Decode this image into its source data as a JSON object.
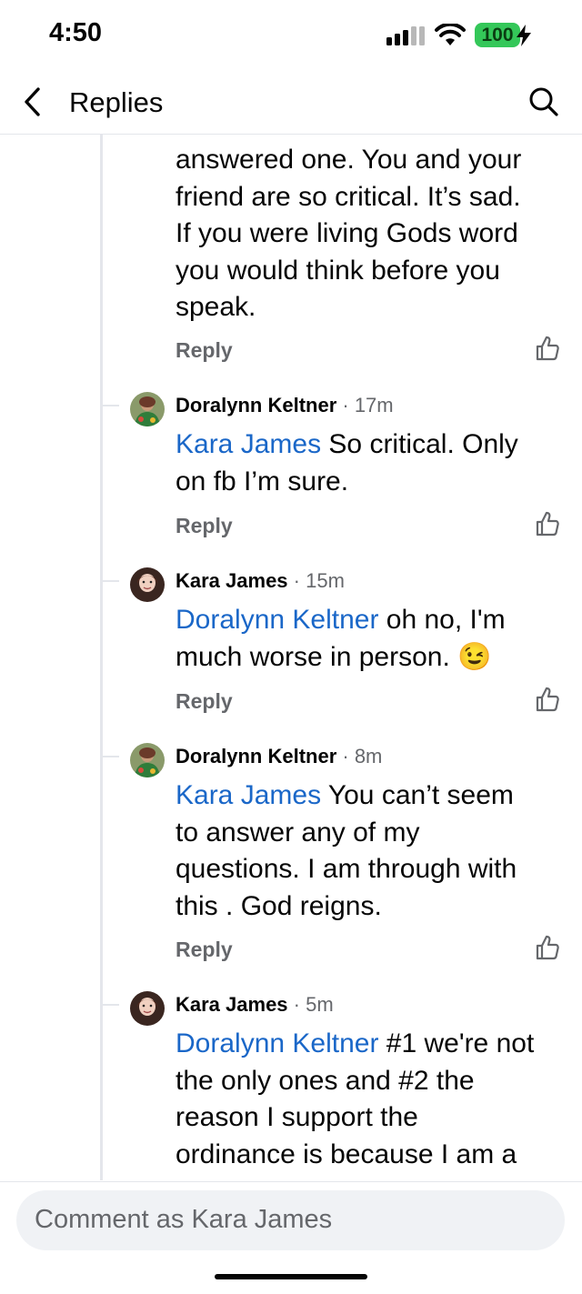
{
  "status": {
    "time": "4:50",
    "battery": "100"
  },
  "header": {
    "title": "Replies"
  },
  "top_comment": {
    "lines": [
      "answered one.  You and your",
      "friend are so critical.  It’s sad.",
      "If you were living Gods word",
      "you would think before you",
      "speak."
    ],
    "reply_label": "Reply"
  },
  "comments": [
    {
      "author": "Doralynn Keltner",
      "time": " · 17m",
      "mention": "Kara James",
      "lines": [
        " So critical. Only",
        "on fb I’m sure."
      ],
      "reply_label": "Reply"
    },
    {
      "author": "Kara James",
      "time": " · 15m",
      "mention": "Doralynn Keltner",
      "lines": [
        " oh no, I'm",
        "much worse in person. 😉"
      ],
      "reply_label": "Reply"
    },
    {
      "author": "Doralynn Keltner",
      "time": " · 8m",
      "mention": "Kara James",
      "lines": [
        " You can’t seem",
        "to answer any of my",
        "questions. I am through with",
        "this . God reigns."
      ],
      "reply_label": "Reply"
    },
    {
      "author": "Kara James",
      "time": " · 5m",
      "mention": "Doralynn Keltner",
      "lines": [
        " #1 we're not",
        "the only ones and #2 the",
        "reason I support the",
        "ordinance is because I am a"
      ],
      "reply_label": ""
    }
  ],
  "composer": {
    "placeholder": "Comment as Kara James"
  },
  "colors": {
    "mention": "#1a67c8",
    "muted": "#65676b",
    "battery": "#34c759"
  }
}
